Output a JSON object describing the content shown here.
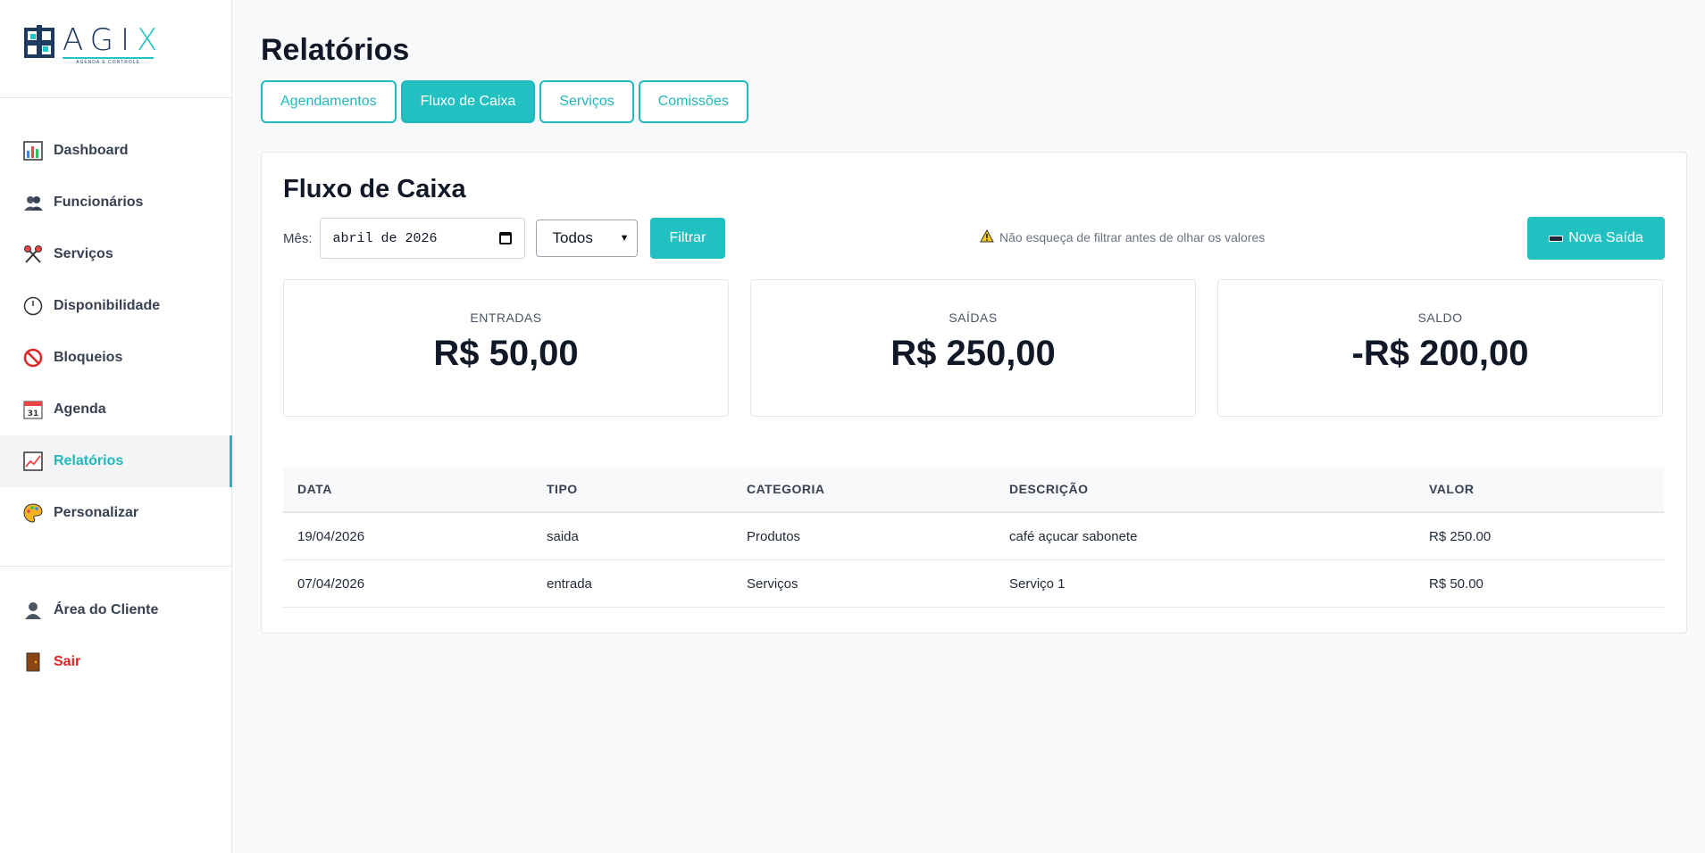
{
  "logo": {
    "word_main": "AGI",
    "word_accent": "X",
    "tagline": "AGENDA E CONTROLE"
  },
  "sidebar": {
    "items": [
      {
        "label": "Dashboard",
        "icon": "bar-chart-icon"
      },
      {
        "label": "Funcionários",
        "icon": "people-icon"
      },
      {
        "label": "Serviços",
        "icon": "scissors-icon"
      },
      {
        "label": "Disponibilidade",
        "icon": "clock-icon"
      },
      {
        "label": "Bloqueios",
        "icon": "prohibited-icon"
      },
      {
        "label": "Agenda",
        "icon": "calendar-icon"
      },
      {
        "label": "Relatórios",
        "icon": "trend-chart-icon",
        "active": true
      },
      {
        "label": "Personalizar",
        "icon": "palette-icon"
      }
    ],
    "footer_items": [
      {
        "label": "Área do Cliente",
        "icon": "user-icon"
      },
      {
        "label": "Sair",
        "icon": "door-icon"
      }
    ]
  },
  "page": {
    "title": "Relatórios"
  },
  "tabs": [
    {
      "label": "Agendamentos"
    },
    {
      "label": "Fluxo de Caixa",
      "active": true
    },
    {
      "label": "Serviços"
    },
    {
      "label": "Comissões"
    }
  ],
  "cashflow": {
    "title": "Fluxo de Caixa",
    "month_label": "Mês:",
    "month_value": "abril de 2026",
    "type_filter": "Todos",
    "filter_button": "Filtrar",
    "warning": "Não esqueça de filtrar antes de olhar os valores",
    "new_button": "Nova Saída",
    "stats": {
      "entradas": {
        "label": "ENTRADAS",
        "value": "R$ 50,00"
      },
      "saidas": {
        "label": "SAÍDAS",
        "value": "R$ 250,00"
      },
      "saldo": {
        "label": "SALDO",
        "value": "-R$ 200,00"
      }
    },
    "table": {
      "headers": [
        "DATA",
        "TIPO",
        "CATEGORIA",
        "DESCRIÇÃO",
        "VALOR"
      ],
      "rows": [
        [
          "19/04/2026",
          "saida",
          "Produtos",
          "café açucar sabonete",
          "R$ 250.00"
        ],
        [
          "07/04/2026",
          "entrada",
          "Serviços",
          "Serviço 1",
          "R$ 50.00"
        ]
      ]
    }
  },
  "colors": {
    "accent": "#22c0c0",
    "danger": "#dc2626",
    "text": "#111827"
  }
}
